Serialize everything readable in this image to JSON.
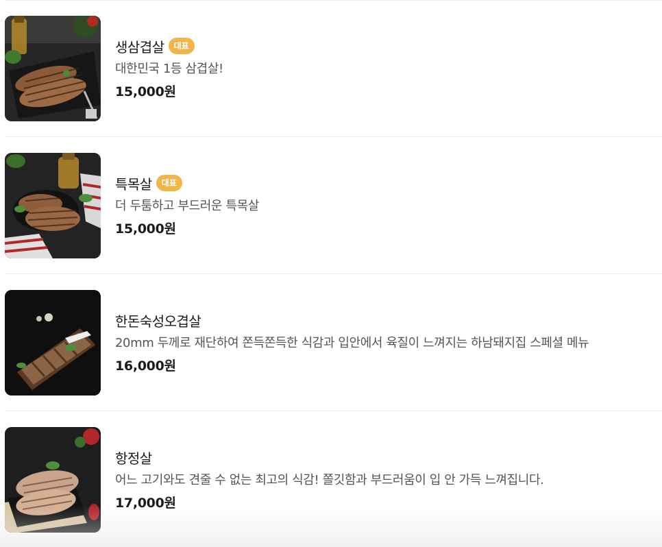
{
  "menu": {
    "items": [
      {
        "name": "생삼겹살",
        "badge": "대표",
        "description": "대한민국 1등 삼겹살!",
        "price": "15,000원",
        "image_icon": "grilled-pork-belly-photo"
      },
      {
        "name": "특목살",
        "badge": "대표",
        "description": "더 두툼하고 부드러운 특목살",
        "price": "15,000원",
        "image_icon": "grilled-pork-neck-photo"
      },
      {
        "name": "한돈숙성오겹살",
        "badge": "",
        "description": "20mm 두께로 재단하여 쫀득쫀득한 식감과 입안에서 육질이 느껴지는 하남돼지집 스페셜 메뉴",
        "price": "16,000원",
        "image_icon": "aged-pork-belly-photo"
      },
      {
        "name": "항정살",
        "badge": "",
        "description": "어느 고기와도 견줄 수 없는 최고의 식감! 쫄깃함과 부드러움이 입 안 가득 느껴집니다.",
        "price": "17,000원",
        "image_icon": "pork-jowl-photo"
      }
    ],
    "colors": {
      "badge_bg": "#f2b54a",
      "price_text": "#1a1a1a",
      "desc_text": "#555555"
    }
  }
}
